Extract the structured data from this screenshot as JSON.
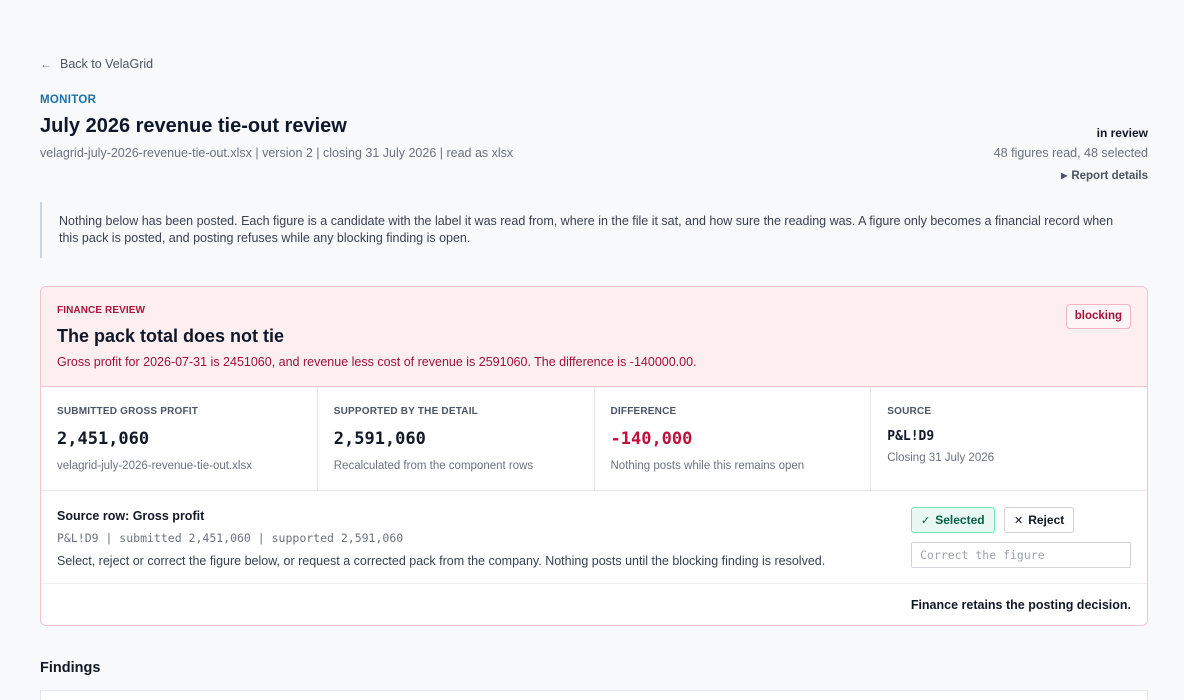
{
  "nav": {
    "back_label": "Back to VelaGrid"
  },
  "header": {
    "eyebrow": "MONITOR",
    "title": "July 2026 revenue tie-out review",
    "meta": "velagrid-july-2026-revenue-tie-out.xlsx | version 2 | closing 31 July 2026 | read as xlsx",
    "status": "in review",
    "counts": "48 figures read, 48 selected",
    "details_label": "Report details"
  },
  "notice": "Nothing below has been posted. Each figure is a candidate with the label it was read from, where in the file it sat, and how sure the reading was. A figure only becomes a financial record when this pack is posted, and posting refuses while any blocking finding is open.",
  "finding": {
    "label": "FINANCE REVIEW",
    "title": "The pack total does not tie",
    "message": "Gross profit for 2026-07-31 is 2451060, and revenue less cost of revenue is 2591060. The difference is -140000.00.",
    "badge": "blocking",
    "stats": [
      {
        "label": "SUBMITTED GROSS PROFIT",
        "value": "2,451,060",
        "sub": "velagrid-july-2026-revenue-tie-out.xlsx"
      },
      {
        "label": "SUPPORTED BY THE DETAIL",
        "value": "2,591,060",
        "sub": "Recalculated from the component rows"
      },
      {
        "label": "DIFFERENCE",
        "value": "-140,000",
        "sub": "Nothing posts while this remains open"
      },
      {
        "label": "SOURCE",
        "value": "P&L!D9",
        "sub": "Closing 31 July 2026"
      }
    ],
    "source_row": {
      "title": "Source row: Gross profit",
      "detail": "P&L!D9 | submitted 2,451,060 | supported 2,591,060",
      "help": "Select, reject or correct the figure below, or request a corrected pack from the company. Nothing posts until the blocking finding is resolved.",
      "selected_label": "Selected",
      "reject_label": "Reject",
      "correct_placeholder": "Correct the figure"
    },
    "footer": "Finance retains the posting decision."
  },
  "findings_heading": "Findings",
  "colors": {
    "accent": "#1d6fa8",
    "danger": "#be123c",
    "success": "#065f46"
  }
}
